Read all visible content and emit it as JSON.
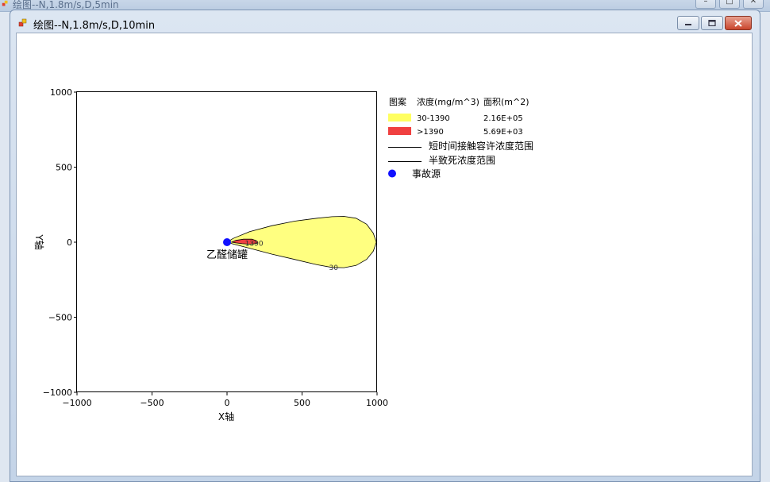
{
  "background_window": {
    "title": "绘图--N,1.8m/s,D,5min"
  },
  "window": {
    "title": "绘图--N,1.8m/s,D,10min"
  },
  "chart_data": {
    "type": "contour",
    "xlabel": "X轴",
    "ylabel": "Y轴",
    "xlim": [
      -1000,
      1000
    ],
    "ylim": [
      -1000,
      1000
    ],
    "x_ticks": [
      "−1000",
      "−500",
      "0",
      "500",
      "1000"
    ],
    "y_ticks": [
      "1000",
      "500",
      "0",
      "−500",
      "−1000"
    ],
    "source": {
      "label": "乙醛储罐",
      "x": 0,
      "y": 0,
      "color": "#1010ff"
    },
    "contours": [
      {
        "label": "30",
        "range": "30-1390",
        "area": "2.16E+05",
        "color": "#ffff80",
        "upper": [
          [
            0,
            0
          ],
          [
            40,
            25
          ],
          [
            150,
            70
          ],
          [
            300,
            110
          ],
          [
            450,
            140
          ],
          [
            600,
            160
          ],
          [
            700,
            170
          ],
          [
            780,
            172
          ],
          [
            860,
            160
          ],
          [
            930,
            120
          ],
          [
            975,
            60
          ],
          [
            995,
            0
          ]
        ],
        "lower": [
          [
            995,
            0
          ],
          [
            975,
            -60
          ],
          [
            930,
            -115
          ],
          [
            860,
            -155
          ],
          [
            780,
            -170
          ],
          [
            700,
            -168
          ],
          [
            600,
            -150
          ],
          [
            450,
            -115
          ],
          [
            300,
            -80
          ],
          [
            150,
            -40
          ],
          [
            40,
            -12
          ],
          [
            0,
            0
          ]
        ]
      },
      {
        "label": "1390",
        "range": ">1390",
        "area": "5.69E+03",
        "color": "#f04040",
        "upper": [
          [
            30,
            0
          ],
          [
            60,
            12
          ],
          [
            110,
            20
          ],
          [
            165,
            20
          ],
          [
            195,
            10
          ],
          [
            205,
            0
          ]
        ],
        "lower": [
          [
            205,
            0
          ],
          [
            190,
            -10
          ],
          [
            150,
            -13
          ],
          [
            100,
            -10
          ],
          [
            60,
            -5
          ],
          [
            30,
            0
          ]
        ]
      }
    ],
    "legend": {
      "headers": [
        "图案",
        "浓度(mg/m^3)",
        "面积(m^2)"
      ],
      "rows": [
        {
          "range": "30-1390",
          "area": "2.16E+05",
          "color": "#ffff60"
        },
        {
          "range": ">1390",
          "area": "5.69E+03",
          "color": "#f04040"
        }
      ],
      "lines": [
        "短时间接触容许浓度范围",
        "半致死浓度范围"
      ],
      "source_label": "事故源"
    }
  }
}
